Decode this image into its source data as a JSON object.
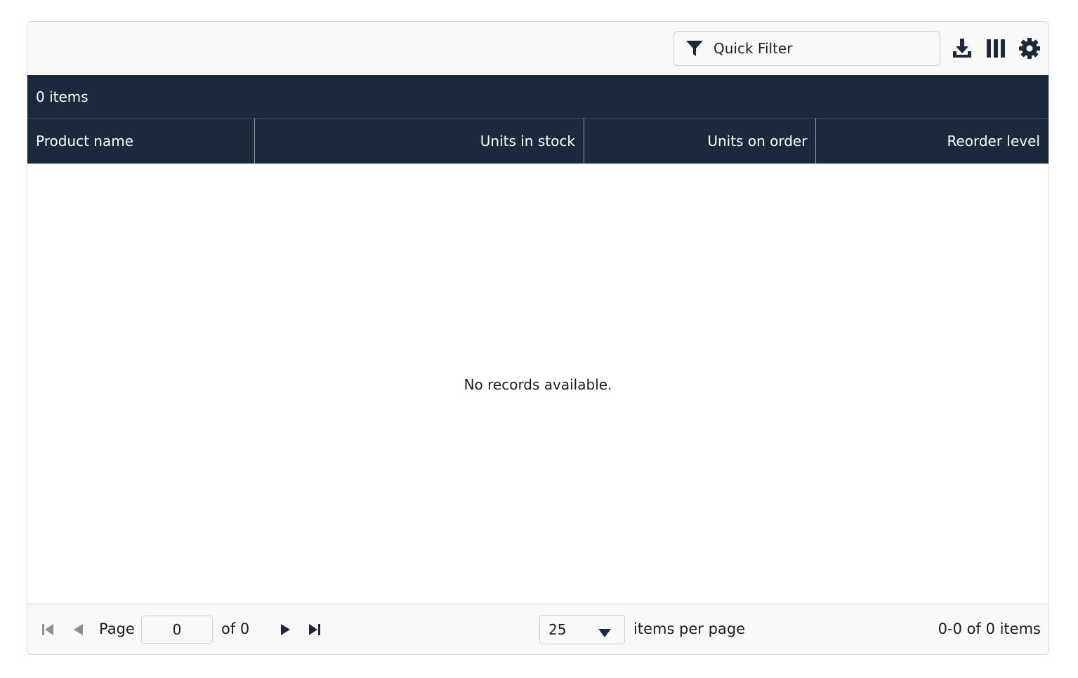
{
  "toolbar": {
    "quick_filter_placeholder": "Quick Filter",
    "icons": [
      "filter-icon",
      "download-icon",
      "columns-icon",
      "settings-icon"
    ]
  },
  "summary": {
    "item_count_label": "0 items"
  },
  "columns": [
    {
      "label": "Product name",
      "align": "left"
    },
    {
      "label": "Units in stock",
      "align": "right"
    },
    {
      "label": "Units on order",
      "align": "right"
    },
    {
      "label": "Reorder level",
      "align": "right"
    }
  ],
  "body": {
    "empty_message": "No records available."
  },
  "pager": {
    "page_label": "Page",
    "current_page": "0",
    "of_label": "of 0",
    "page_size": "25",
    "items_per_page_label": "items per page",
    "range_label": "0-0 of 0 items"
  },
  "colors": {
    "header_bg": "#1a2a3c",
    "header_text": "#ffffff",
    "toolbar_bg": "#f8f8f8",
    "disabled_icon": "#8a8f96",
    "active_icon": "#1a2a3c"
  }
}
